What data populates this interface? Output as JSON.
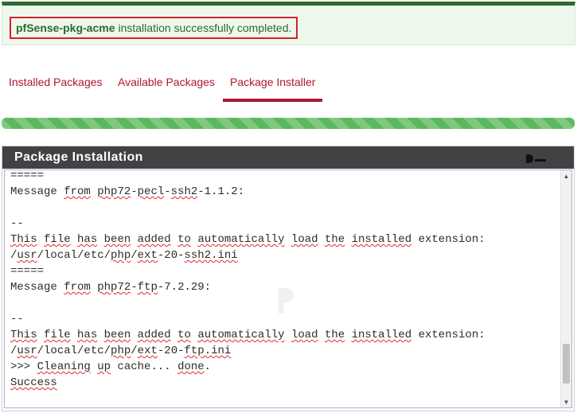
{
  "alert": {
    "package_name": "pfSense-pkg-acme",
    "message": "installation successfully completed."
  },
  "tabs": [
    {
      "label": "Installed Packages"
    },
    {
      "label": "Available Packages"
    },
    {
      "label": "Package Installer",
      "active": true
    }
  ],
  "progress": {
    "percent": 100,
    "color": "#5cb85c"
  },
  "panel": {
    "title": "Package Installation",
    "log": [
      [
        {
          "t": "====="
        }
      ],
      [
        {
          "t": "Message "
        },
        {
          "t": "from",
          "s": 1
        },
        {
          "t": " "
        },
        {
          "t": "php72",
          "s": 1
        },
        {
          "t": "-"
        },
        {
          "t": "pecl",
          "s": 1
        },
        {
          "t": "-"
        },
        {
          "t": "ssh2",
          "s": 1
        },
        {
          "t": "-1.1.2:"
        }
      ],
      [
        {
          "t": " "
        }
      ],
      [
        {
          "t": "--"
        }
      ],
      [
        {
          "t": "This",
          "s": 1
        },
        {
          "t": " "
        },
        {
          "t": "file",
          "s": 1
        },
        {
          "t": " "
        },
        {
          "t": "has",
          "s": 1
        },
        {
          "t": " "
        },
        {
          "t": "been",
          "s": 1
        },
        {
          "t": " "
        },
        {
          "t": "added",
          "s": 1
        },
        {
          "t": " "
        },
        {
          "t": "to",
          "s": 1
        },
        {
          "t": " "
        },
        {
          "t": "automatically",
          "s": 1
        },
        {
          "t": " "
        },
        {
          "t": "load",
          "s": 1
        },
        {
          "t": " "
        },
        {
          "t": "the",
          "s": 1
        },
        {
          "t": " "
        },
        {
          "t": "installed",
          "s": 1
        },
        {
          "t": " extension:"
        }
      ],
      [
        {
          "t": "/"
        },
        {
          "t": "usr",
          "s": 1
        },
        {
          "t": "/local/etc/"
        },
        {
          "t": "php",
          "s": 1
        },
        {
          "t": "/"
        },
        {
          "t": "ext",
          "s": 1
        },
        {
          "t": "-20-"
        },
        {
          "t": "ssh2.ini",
          "s": 1
        }
      ],
      [
        {
          "t": "====="
        }
      ],
      [
        {
          "t": "Message "
        },
        {
          "t": "from",
          "s": 1
        },
        {
          "t": " "
        },
        {
          "t": "php72",
          "s": 1
        },
        {
          "t": "-"
        },
        {
          "t": "ftp",
          "s": 1
        },
        {
          "t": "-7.2.29:"
        }
      ],
      [
        {
          "t": " "
        }
      ],
      [
        {
          "t": "--"
        }
      ],
      [
        {
          "t": "This",
          "s": 1
        },
        {
          "t": " "
        },
        {
          "t": "file",
          "s": 1
        },
        {
          "t": " "
        },
        {
          "t": "has",
          "s": 1
        },
        {
          "t": " "
        },
        {
          "t": "been",
          "s": 1
        },
        {
          "t": " "
        },
        {
          "t": "added",
          "s": 1
        },
        {
          "t": " "
        },
        {
          "t": "to",
          "s": 1
        },
        {
          "t": " "
        },
        {
          "t": "automatically",
          "s": 1
        },
        {
          "t": " "
        },
        {
          "t": "load",
          "s": 1
        },
        {
          "t": " "
        },
        {
          "t": "the",
          "s": 1
        },
        {
          "t": " "
        },
        {
          "t": "installed",
          "s": 1
        },
        {
          "t": " extension:"
        }
      ],
      [
        {
          "t": "/"
        },
        {
          "t": "usr",
          "s": 1
        },
        {
          "t": "/local/etc/"
        },
        {
          "t": "php",
          "s": 1
        },
        {
          "t": "/"
        },
        {
          "t": "ext",
          "s": 1
        },
        {
          "t": "-20-"
        },
        {
          "t": "ftp.ini",
          "s": 1
        }
      ],
      [
        {
          "t": ">>> "
        },
        {
          "t": "Cleaning",
          "s": 1
        },
        {
          "t": " "
        },
        {
          "t": "up",
          "s": 1
        },
        {
          "t": " cache... "
        },
        {
          "t": "done",
          "s": 1
        },
        {
          "t": "."
        }
      ],
      [
        {
          "t": "Success",
          "s": 1
        }
      ]
    ]
  },
  "colors": {
    "success_border": "#2d6a2e",
    "success_bg": "#eef7ec",
    "alert_highlight": "#d3232b",
    "tab_link": "#b1172d",
    "panel_header": "#424242"
  },
  "icons": {
    "scroll_up": "arrow-up-icon",
    "scroll_down": "arrow-down-icon",
    "watermark": "brand-watermark-icon"
  }
}
